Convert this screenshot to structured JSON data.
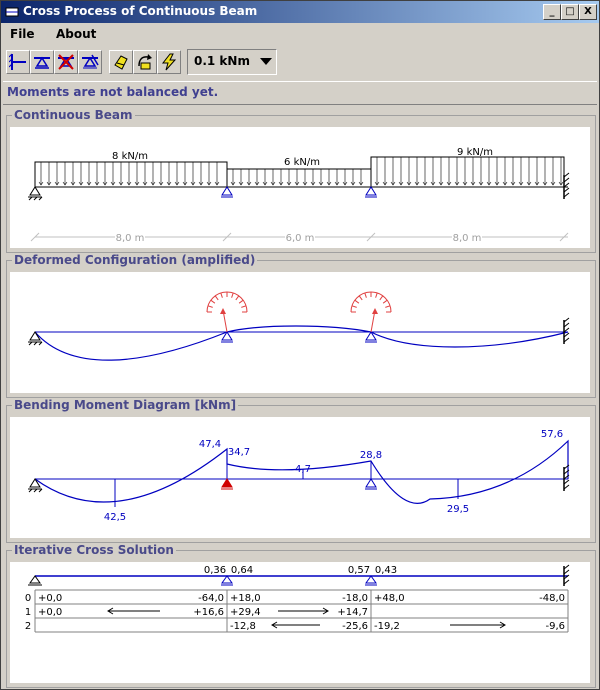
{
  "window": {
    "title": "Cross Process of Continuous Beam"
  },
  "window_buttons": {
    "minimize": "_",
    "maximize": "□",
    "close": "X"
  },
  "menu": [
    "File",
    "About"
  ],
  "toolbar": {
    "unit_select": "0.1 kNm"
  },
  "status": "Moments are not balanced yet.",
  "panels": {
    "beam": "Continuous Beam",
    "deformed": "Deformed Configuration (amplified)",
    "moment": "Bending Moment Diagram [kNm]",
    "cross": "Iterative Cross Solution"
  },
  "beam": {
    "loads": [
      "8  kN/m",
      "6  kN/m",
      "9  kN/m"
    ],
    "spans": [
      "8,0 m",
      "6,0 m",
      "8,0 m"
    ]
  },
  "moments": {
    "support_left": "47,4",
    "support_right": "34,7",
    "mid1": "42,5",
    "mid2": "4,7",
    "support2": "28,8",
    "mid3": "29,5",
    "end": "57,6"
  },
  "cross": {
    "factors": [
      "0,36",
      "0,64",
      "0,57",
      "0,43"
    ],
    "rows": [
      {
        "idx": "0",
        "c1l": "+0,0",
        "c1r": "-64,0",
        "c2l": "+18,0",
        "c2r": "-18,0",
        "c3l": "+48,0",
        "c3r": "-48,0"
      },
      {
        "idx": "1",
        "c1l": "+0,0",
        "c1r": "+16,6",
        "c2l": "+29,4",
        "c2r": "+14,7",
        "c3l": "",
        "c3r": ""
      },
      {
        "idx": "2",
        "c1l": "",
        "c1r": "",
        "c2l": "-12,8",
        "c2r": "-25,6",
        "c3l": "-19,2",
        "c3r": "-9,6"
      }
    ]
  },
  "colors": {
    "member": "#0000c0",
    "load": "#000000",
    "highlight": "#d00000",
    "arc": "#e04040"
  },
  "icons": [
    "add-fixed-support-icon",
    "add-pin-support-icon",
    "remove-support-icon",
    "add-member-icon",
    "load-icon",
    "moment-icon",
    "step-icon",
    "minimize-icon",
    "maximize-icon",
    "close-icon"
  ]
}
